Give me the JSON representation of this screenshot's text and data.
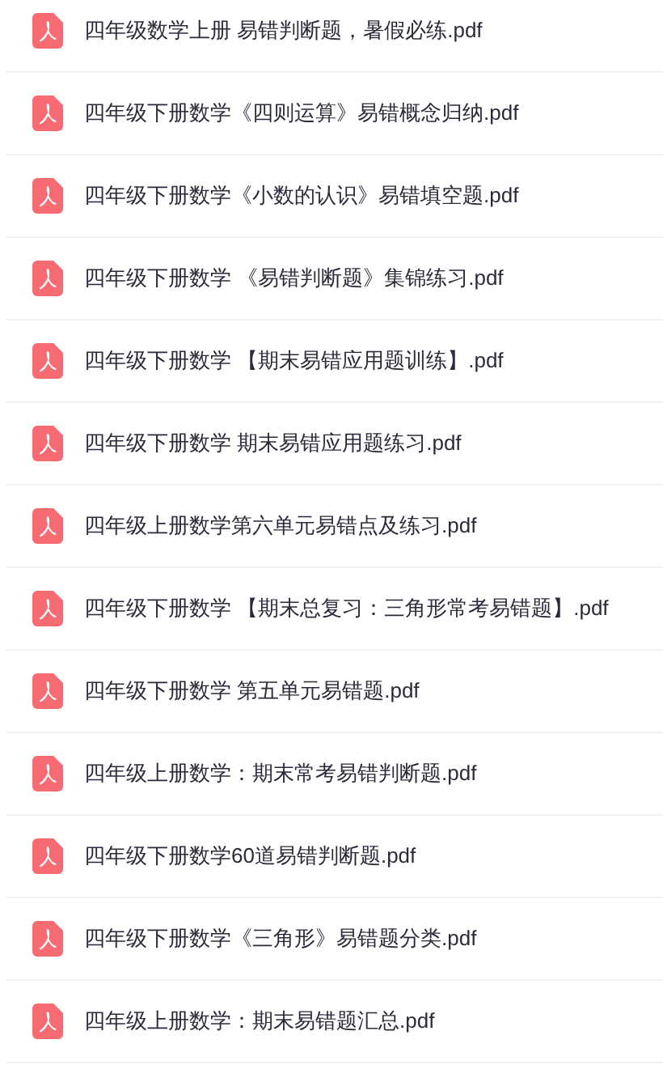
{
  "files": [
    {
      "name": "四年级数学上册 易错判断题，暑假必练.pdf"
    },
    {
      "name": "四年级下册数学《四则运算》易错概念归纳.pdf"
    },
    {
      "name": "四年级下册数学《小数的认识》易错填空题.pdf"
    },
    {
      "name": "四年级下册数学 《易错判断题》集锦练习.pdf"
    },
    {
      "name": "四年级下册数学 【期末易错应用题训练】.pdf"
    },
    {
      "name": "四年级下册数学 期末易错应用题练习.pdf"
    },
    {
      "name": "四年级上册数学第六单元易错点及练习.pdf"
    },
    {
      "name": "四年级下册数学 【期末总复习：三角形常考易错题】.pdf"
    },
    {
      "name": "四年级下册数学 第五单元易错题.pdf"
    },
    {
      "name": "四年级上册数学：期末常考易错判断题.pdf"
    },
    {
      "name": "四年级下册数学60道易错判断题.pdf"
    },
    {
      "name": "四年级下册数学《三角形》易错题分类.pdf"
    },
    {
      "name": "四年级上册数学：期末易错题汇总.pdf"
    }
  ]
}
